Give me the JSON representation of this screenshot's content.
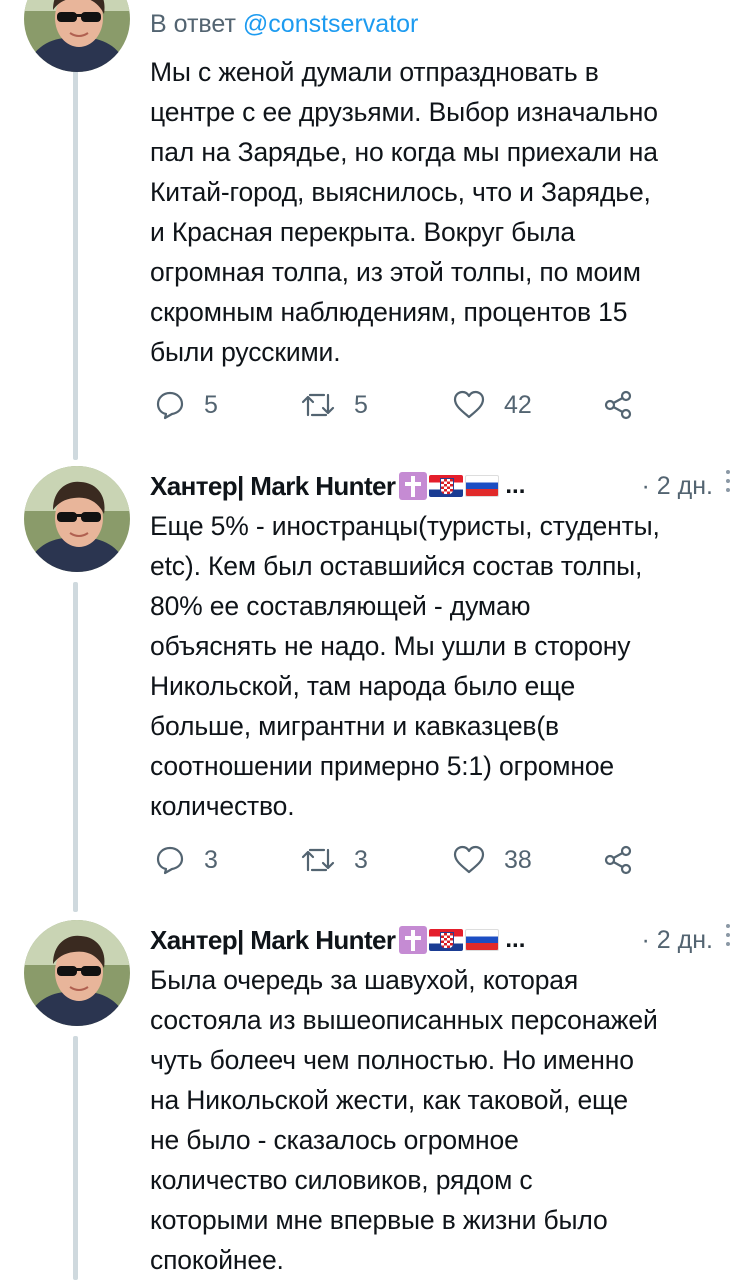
{
  "tweets": [
    {
      "reply_to_prefix": "В ответ",
      "reply_to_handle": "@constservator",
      "lines": [
        "Мы с женой думали отпраздновать в",
        "центре с ее друзьями. Выбор изначально",
        "пал на Зарядье, но когда мы приехали на",
        "Китай-город, выяснилось, что и Зарядье,",
        "и Красная перекрыта. Вокруг была",
        "огромная толпа, из этой толпы, по моим",
        "скромным наблюдениям, процентов 15",
        "были русскими."
      ],
      "stats": {
        "replies": "5",
        "retweets": "5",
        "likes": "42"
      }
    },
    {
      "author": "Хантер| Mark Hunter",
      "ellipsis": "...",
      "time": "· 2 дн.",
      "lines": [
        "Еще 5% - иностранцы(туристы, студенты,",
        "etc). Кем был оставшийся состав толпы,",
        "80% ее составляющей - думаю",
        "объяснять не надо. Мы ушли в сторону",
        "Никольской, там народа было еще",
        "больше, мигрантни и кавказцев(в",
        "соотношении примерно 5:1) огромное",
        "количество."
      ],
      "stats": {
        "replies": "3",
        "retweets": "3",
        "likes": "38"
      }
    },
    {
      "author": "Хантер| Mark Hunter",
      "ellipsis": "...",
      "time": "· 2 дн.",
      "lines": [
        "Была очередь за шавухой, которая",
        "состояла из вышеописанных персонажей",
        "чуть болееч чем полностью. Но именно",
        "на Никольской жести, как таковой, еще",
        "не было - сказалось огромное",
        "количество силовиков, рядом с",
        "которыми мне впервые в жизни было",
        "спокойнее."
      ]
    }
  ],
  "icons": {
    "reply": "reply-bubble-icon",
    "retweet": "retweet-icon",
    "like": "heart-icon",
    "share": "share-icon",
    "more": "more-vertical-icon",
    "verified_badge": "orthodox-cross-badge",
    "flags": [
      "croatia-flag",
      "russia-flag"
    ]
  },
  "colors": {
    "text": "#0f1419",
    "secondary": "#536471",
    "link": "#1d9bf0",
    "thread_line": "#cfd9de"
  }
}
